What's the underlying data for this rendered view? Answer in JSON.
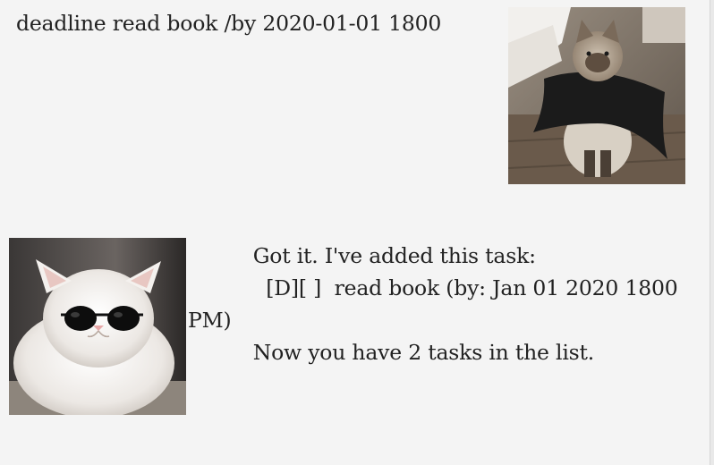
{
  "user_message": {
    "text": "deadline read book /by 2020-01-01 1800",
    "avatar": "siamese-cat-in-cape-avatar"
  },
  "duke_message": {
    "text": "          Got it. I've added this task:\n            [D][ ]  read book (by: Jan 01 2020 1800 PM)\n          Now you have 2 tasks in the list.",
    "avatar": "white-cat-with-sunglasses-avatar"
  },
  "colors": {
    "background": "#f4f4f4",
    "text": "#222222"
  }
}
